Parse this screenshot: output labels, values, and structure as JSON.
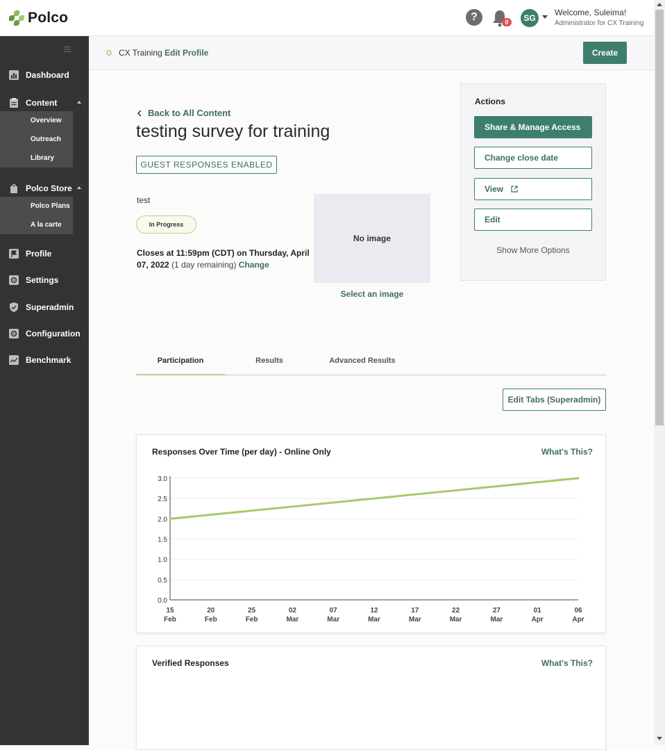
{
  "topbar": {
    "logo_text": "Polco",
    "help_glyph": "?",
    "notification_count": "0",
    "avatar_initials": "SG",
    "welcome": "Welcome, Suleima!",
    "role": "Administrator for CX Training",
    "icons": [
      "help-icon",
      "bell-icon",
      "chevron-down-icon"
    ]
  },
  "sidebar": {
    "items": [
      {
        "label": "Dashboard",
        "icon": "bar-chart-icon"
      },
      {
        "label": "Content",
        "icon": "clipboard-icon"
      },
      {
        "label": "Polco Store",
        "icon": "shopping-bag-icon"
      },
      {
        "label": "Profile",
        "icon": "flag-icon"
      },
      {
        "label": "Settings",
        "icon": "gear-icon"
      },
      {
        "label": "Superadmin",
        "icon": "shield-icon"
      },
      {
        "label": "Configuration",
        "icon": "gear-icon"
      },
      {
        "label": "Benchmark",
        "icon": "trend-icon"
      }
    ],
    "content_sub": [
      "Overview",
      "Outreach",
      "Library"
    ],
    "store_sub": [
      "Polco Plans",
      "A la carte"
    ]
  },
  "subheader": {
    "org_name": "CX Training",
    "edit_profile": "Edit Profile",
    "create_label": "Create"
  },
  "main": {
    "back_label": "Back to All Content",
    "title": "testing survey for training",
    "guest_badge": "GUEST RESPONSES ENABLED",
    "description": "test",
    "status": "In Progress",
    "closes_prefix": "Closes at 11:59pm (CDT) on Thursday, April 07, 2022",
    "remaining": "(1 day remaining)",
    "change_label": "Change",
    "no_image": "No image",
    "select_image": "Select an image"
  },
  "actions": {
    "title": "Actions",
    "share": "Share & Manage Access",
    "change_close": "Change close date",
    "view": "View",
    "edit": "Edit",
    "more": "Show More Options"
  },
  "tabs": [
    "Participation",
    "Results",
    "Advanced Results"
  ],
  "edit_tabs_label": "Edit Tabs (Superadmin)",
  "cards": {
    "responses_title": "Responses Over Time (per day) - Online Only",
    "verified_title": "Verified Responses",
    "whats_this": "What's This?"
  },
  "colors": {
    "primary": "#3e7e6c",
    "accent_green": "#a8c96b",
    "sidebar": "#333333"
  },
  "chart_data": {
    "type": "line",
    "title": "Responses Over Time (per day) - Online Only",
    "x": [
      "15 Feb",
      "20 Feb",
      "25 Feb",
      "02 Mar",
      "07 Mar",
      "12 Mar",
      "17 Mar",
      "22 Mar",
      "27 Mar",
      "01 Apr",
      "06 Apr"
    ],
    "x_ticks": [
      [
        "15",
        "Feb"
      ],
      [
        "20",
        "Feb"
      ],
      [
        "25",
        "Feb"
      ],
      [
        "02",
        "Mar"
      ],
      [
        "07",
        "Mar"
      ],
      [
        "12",
        "Mar"
      ],
      [
        "17",
        "Mar"
      ],
      [
        "22",
        "Mar"
      ],
      [
        "27",
        "Mar"
      ],
      [
        "01",
        "Apr"
      ],
      [
        "06",
        "Apr"
      ]
    ],
    "series": [
      {
        "x_start": "2022-02-15",
        "x_end": "2022-04-06",
        "y_start": 2.0,
        "y_end": 3.0
      }
    ],
    "y_ticks": [
      "0.0",
      "0.5",
      "1.0",
      "1.5",
      "2.0",
      "2.5",
      "3.0"
    ],
    "ylim": [
      0,
      3
    ],
    "grid": true
  }
}
